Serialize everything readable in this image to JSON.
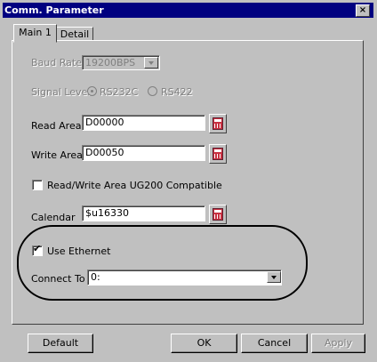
{
  "window": {
    "title": "Comm. Parameter",
    "close_glyph": "×"
  },
  "tabs": [
    {
      "label": "Main 1"
    },
    {
      "label": "Detail"
    }
  ],
  "baud_rate": {
    "label": "Baud Rate",
    "value": "19200BPS"
  },
  "signal_level": {
    "label": "Signal Level",
    "options": [
      "RS232C",
      "RS422"
    ],
    "selected": "RS232C"
  },
  "read_area": {
    "label": "Read Area",
    "value": "D00000"
  },
  "write_area": {
    "label": "Write Area",
    "value": "D00050"
  },
  "compat": {
    "label": "Read/Write Area UG200 Compatible",
    "checked": false
  },
  "calendar": {
    "label": "Calendar",
    "value": "$u16330"
  },
  "ethernet": {
    "label": "Use Ethernet",
    "checked": true,
    "check_glyph": "✔"
  },
  "connect_to": {
    "label": "Connect To",
    "value": "0:"
  },
  "buttons": {
    "default": "Default",
    "ok": "OK",
    "cancel": "Cancel",
    "apply": "Apply"
  },
  "icons": {
    "address_picker": "calculator-icon",
    "dropdown": "chevron-down-icon"
  }
}
